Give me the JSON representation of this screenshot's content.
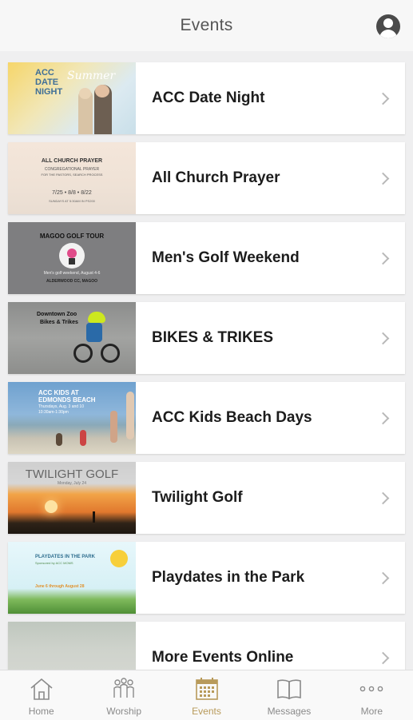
{
  "header": {
    "title": "Events",
    "profile_icon": "user-circle-icon"
  },
  "events": [
    {
      "title": "ACC Date Night",
      "thumb_text": [
        "ACC",
        "DATE",
        "NIGHT",
        "Summer"
      ]
    },
    {
      "title": "All Church Prayer",
      "thumb_text": [
        "ALL CHURCH PRAYER",
        "CONGREGATIONAL PRAYER",
        "FOR THE PASTORS, SEARCH PROCESS",
        "7/25 • 8/8 • 8/22",
        "SUNDAYS AT 5:30AM IN PS200"
      ]
    },
    {
      "title": "Men's Golf Weekend",
      "thumb_text": [
        "MAGOO GOLF TOUR",
        "Men's golf weekend, August 4-6",
        "ALDERWOOD CC, MAGOO"
      ]
    },
    {
      "title": "BIKES & TRIKES",
      "thumb_text": [
        "Downtown Zoo",
        "Bikes & Trikes"
      ]
    },
    {
      "title": "ACC Kids Beach Days",
      "thumb_text": [
        "ACC KIDS AT",
        "EDMONDS BEACH",
        "Thursdays, Aug. 3 and 10",
        "10:30am-1:30pm"
      ]
    },
    {
      "title": "Twilight Golf",
      "thumb_text": [
        "TWILIGHT GOLF",
        "Monday, July 24"
      ]
    },
    {
      "title": "Playdates in the Park",
      "thumb_text": [
        "PLAYDATES IN THE PARK",
        "Sponsored by ACC MOMS",
        "June 6 through August 28"
      ]
    },
    {
      "title": "More Events Online",
      "thumb_text": []
    }
  ],
  "tabs": [
    {
      "label": "Home",
      "icon": "home-icon",
      "active": false
    },
    {
      "label": "Worship",
      "icon": "people-icon",
      "active": false
    },
    {
      "label": "Events",
      "icon": "calendar-icon",
      "active": true
    },
    {
      "label": "Messages",
      "icon": "book-icon",
      "active": false
    },
    {
      "label": "More",
      "icon": "more-icon",
      "active": false
    }
  ],
  "colors": {
    "accent": "#b89a5a",
    "header_bg": "#f7f7f7",
    "page_bg": "#efeff0"
  }
}
